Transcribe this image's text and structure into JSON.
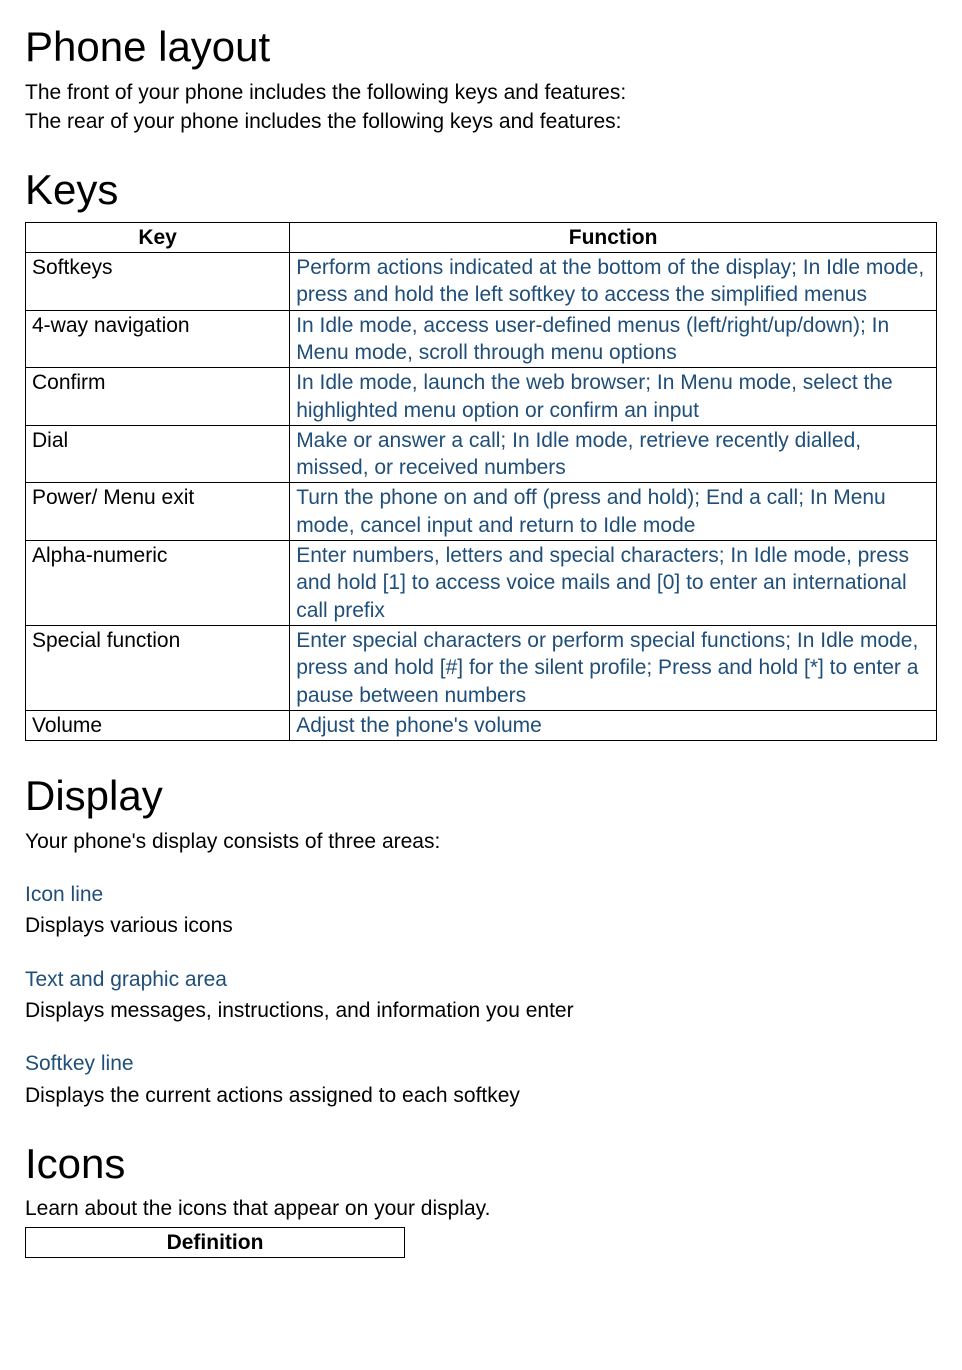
{
  "headings": {
    "phone_layout": "Phone layout",
    "keys": "Keys",
    "display": "Display",
    "icons": "Icons"
  },
  "intro": {
    "front": "The front of your phone includes the following keys and features:",
    "rear": "The rear of your phone includes the following keys and features:"
  },
  "keys_table": {
    "headers": {
      "key": "Key",
      "function": "Function"
    },
    "rows": [
      {
        "key": "Softkeys",
        "function": "Perform actions indicated at the bottom of the display; In Idle mode, press and hold the left softkey to access the simplified menus"
      },
      {
        "key": "4-way navigation",
        "function": "In Idle mode, access user-defined menus (left/right/up/down); In Menu mode, scroll through menu options"
      },
      {
        "key": "Confirm",
        "function": "In Idle mode, launch the web browser; In Menu mode, select the highlighted menu option or confirm an input"
      },
      {
        "key": "Dial",
        "function": "Make or answer a call; In Idle mode, retrieve recently dialled, missed, or received numbers"
      },
      {
        "key": "Power/ Menu exit",
        "function": "Turn the phone on and off (press and hold); End a call; In Menu mode, cancel input and return to Idle mode"
      },
      {
        "key": "Alpha-numeric",
        "function": "Enter numbers, letters and special characters; In Idle mode, press and hold [1] to access voice mails and [0] to enter an international call prefix"
      },
      {
        "key": "Special function",
        "function": "Enter special characters or perform special functions; In Idle mode, press and hold [#] for the silent profile; Press and hold [*] to enter a pause between numbers"
      },
      {
        "key": "Volume",
        "function": "Adjust the phone's volume"
      }
    ]
  },
  "display": {
    "intro": "Your phone's display consists of three areas:",
    "areas": [
      {
        "title": "Icon line",
        "desc": "Displays various icons"
      },
      {
        "title": "Text and graphic area",
        "desc": "Displays messages, instructions, and information you enter"
      },
      {
        "title": "Softkey line",
        "desc": "Displays the current actions assigned to each softkey"
      }
    ]
  },
  "icons": {
    "intro": "Learn about the icons that appear on your display.",
    "table_header": "Definition"
  }
}
